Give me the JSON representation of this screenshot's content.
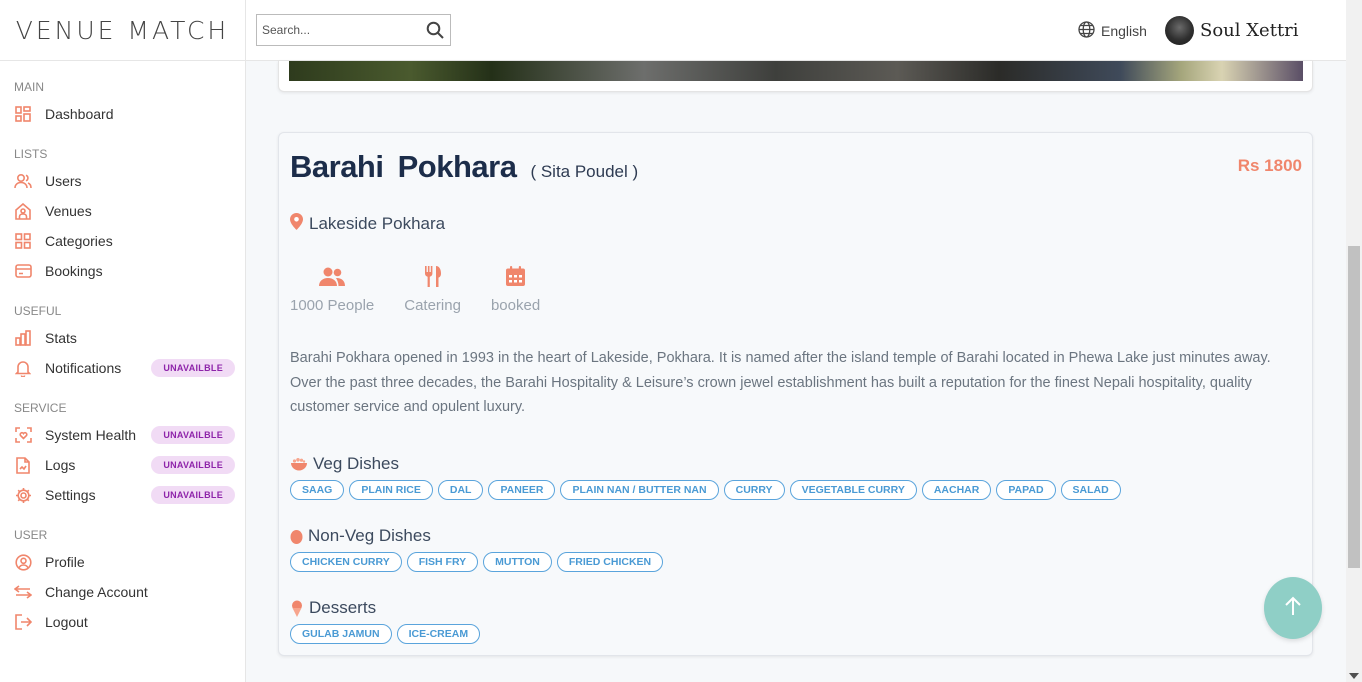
{
  "app": {
    "logo": "VENUE MATCH"
  },
  "sidebar": {
    "sections": {
      "main": "MAIN",
      "lists": "LISTS",
      "useful": "USEFUL",
      "service": "SERVICE",
      "user": "USER"
    },
    "items": {
      "dashboard": "Dashboard",
      "users": "Users",
      "venues": "Venues",
      "categories": "Categories",
      "bookings": "Bookings",
      "stats": "Stats",
      "notifications": "Notifications",
      "system_health": "System Health",
      "logs": "Logs",
      "settings": "Settings",
      "profile": "Profile",
      "change_account": "Change Account",
      "logout": "Logout"
    },
    "badge_text": "UNAVAILBLE"
  },
  "topbar": {
    "search_placeholder": "Search...",
    "language": "English",
    "username": "Soul Xettri"
  },
  "venue": {
    "name": "Barahi  Pokhara",
    "owner": "( Sita Poudel )",
    "price": "Rs 1800",
    "location": "Lakeside Pokhara",
    "features": {
      "capacity": "1000 People",
      "catering": "Catering",
      "status": "booked"
    },
    "description": "Barahi Pokhara opened in 1993 in the heart of Lakeside, Pokhara. It is named after the island temple of Barahi located in Phewa Lake just minutes away. Over the past three decades, the Barahi Hospitality & Leisure’s crown jewel establishment has built a reputation for the finest Nepali hospitality, quality customer service and opulent luxury.",
    "menu": {
      "veg": {
        "title": "Veg Dishes",
        "items": [
          "SAAG",
          "PLAIN RICE",
          "DAL",
          "PANEER",
          "PLAIN NAN / BUTTER NAN",
          "CURRY",
          "VEGETABLE CURRY",
          "AACHAR",
          "PAPAD",
          "SALAD"
        ]
      },
      "nonveg": {
        "title": "Non-Veg Dishes",
        "items": [
          "CHICKEN CURRY",
          "FISH FRY",
          "MUTTON",
          "FRIED CHICKEN"
        ]
      },
      "desserts": {
        "title": "Desserts",
        "items": [
          "GULAB JAMUN",
          "ICE-CREAM"
        ]
      }
    }
  },
  "colors": {
    "accent": "#f0866c",
    "badge_text": "#8e24aa",
    "badge_bg": "#f1dbf5",
    "chip": "#4a9ad4",
    "fab": "#8fcfc6",
    "title": "#1c2d4a"
  },
  "icons": {
    "search": "search-icon",
    "language": "globe-icon",
    "scroll_top": "arrow-up-icon"
  }
}
